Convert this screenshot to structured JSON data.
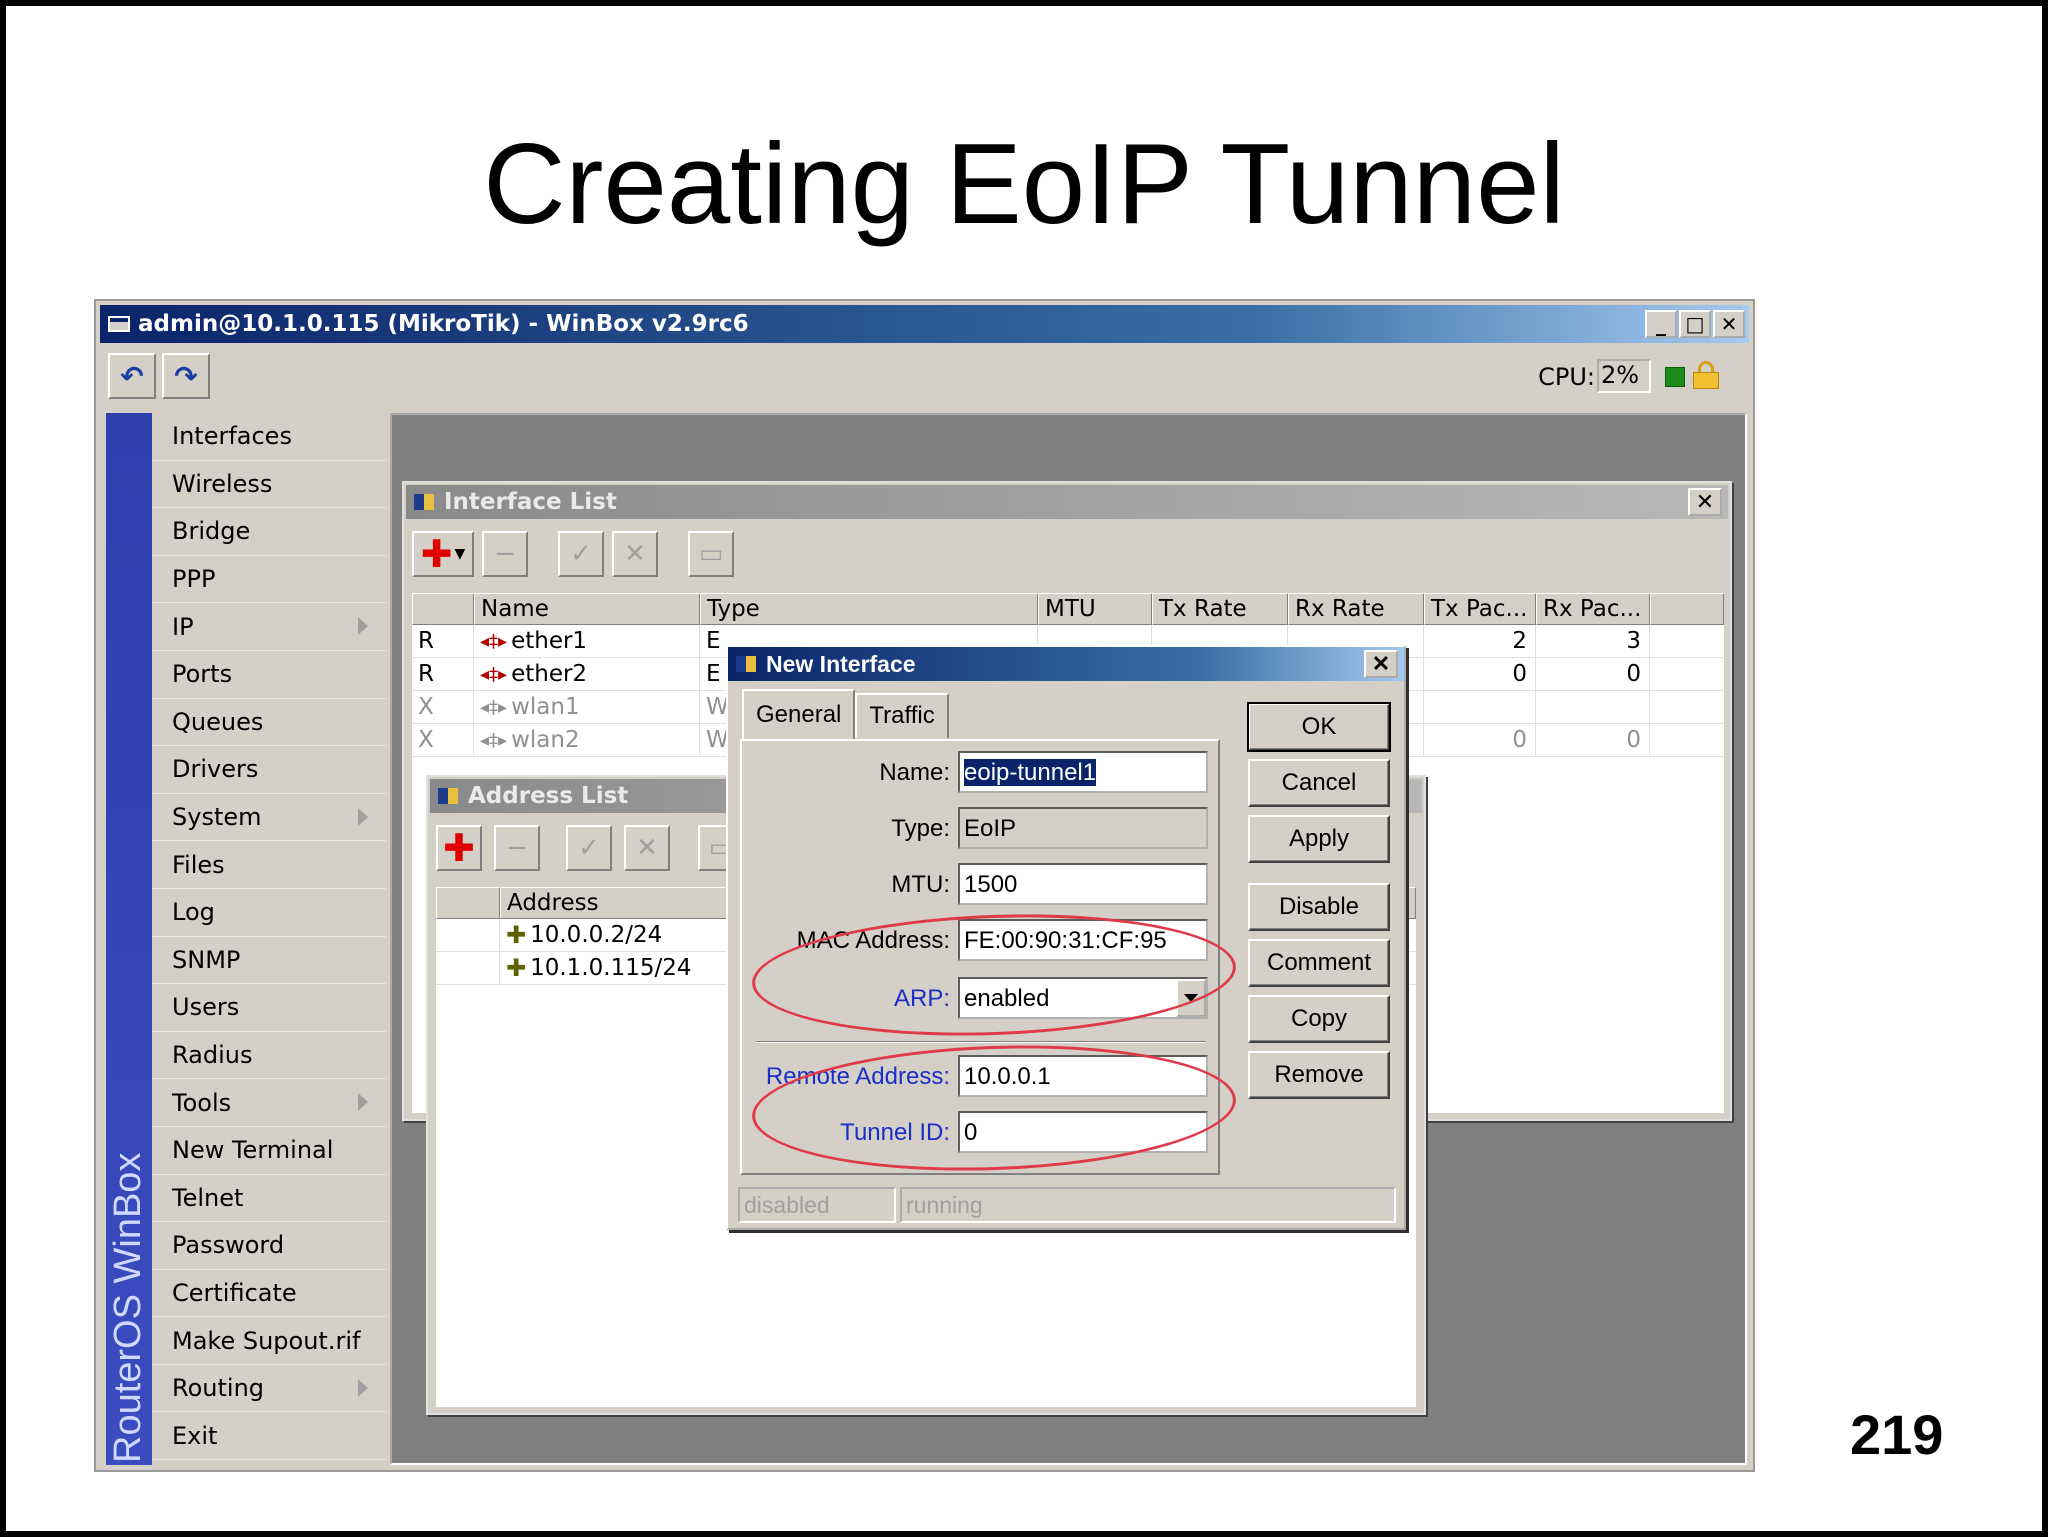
{
  "slide": {
    "title": "Creating EoIP Tunnel",
    "page_number": "219"
  },
  "winbox": {
    "title": "admin@10.1.0.115 (MikroTik) - WinBox v2.9rc6",
    "cpu_label": "CPU:",
    "cpu_value": "2%",
    "brand": "RouterOS WinBox",
    "menu": [
      {
        "label": "Interfaces",
        "submenu": false
      },
      {
        "label": "Wireless",
        "submenu": false
      },
      {
        "label": "Bridge",
        "submenu": false
      },
      {
        "label": "PPP",
        "submenu": false
      },
      {
        "label": "IP",
        "submenu": true
      },
      {
        "label": "Ports",
        "submenu": false
      },
      {
        "label": "Queues",
        "submenu": false
      },
      {
        "label": "Drivers",
        "submenu": false
      },
      {
        "label": "System",
        "submenu": true
      },
      {
        "label": "Files",
        "submenu": false
      },
      {
        "label": "Log",
        "submenu": false
      },
      {
        "label": "SNMP",
        "submenu": false
      },
      {
        "label": "Users",
        "submenu": false
      },
      {
        "label": "Radius",
        "submenu": false
      },
      {
        "label": "Tools",
        "submenu": true
      },
      {
        "label": "New Terminal",
        "submenu": false
      },
      {
        "label": "Telnet",
        "submenu": false
      },
      {
        "label": "Password",
        "submenu": false
      },
      {
        "label": "Certificate",
        "submenu": false
      },
      {
        "label": "Make Supout.rif",
        "submenu": false
      },
      {
        "label": "Routing",
        "submenu": true
      },
      {
        "label": "Exit",
        "submenu": false
      }
    ]
  },
  "interface_list": {
    "title": "Interface List",
    "columns": [
      "Name",
      "Type",
      "MTU",
      "Tx Rate",
      "Rx Rate",
      "Tx Pac...",
      "Rx Pac..."
    ],
    "rows": [
      {
        "flag": "R",
        "name": "ether1",
        "type": "E",
        "tx_pac": "2",
        "rx_pac": "3",
        "disabled": false
      },
      {
        "flag": "R",
        "name": "ether2",
        "type": "E",
        "tx_pac": "0",
        "rx_pac": "0",
        "disabled": false
      },
      {
        "flag": "X",
        "name": "wlan1",
        "type": "W",
        "tx_pac": "",
        "rx_pac": "",
        "disabled": true
      },
      {
        "flag": "X",
        "name": "wlan2",
        "type": "W",
        "tx_pac": "0",
        "rx_pac": "0",
        "disabled": true
      }
    ]
  },
  "address_list": {
    "title": "Address List",
    "column": "Address",
    "rows": [
      "10.0.0.2/24",
      "10.1.0.115/24"
    ]
  },
  "new_interface": {
    "title": "New Interface",
    "tabs": [
      "General",
      "Traffic"
    ],
    "fields": {
      "name": {
        "label": "Name:",
        "value": "eoip-tunnel1"
      },
      "type": {
        "label": "Type:",
        "value": "EoIP"
      },
      "mtu": {
        "label": "MTU:",
        "value": "1500"
      },
      "mac": {
        "label": "MAC Address:",
        "value": "FE:00:90:31:CF:95"
      },
      "arp": {
        "label": "ARP:",
        "value": "enabled"
      },
      "remote": {
        "label": "Remote Address:",
        "value": "10.0.0.1"
      },
      "tunnel_id": {
        "label": "Tunnel ID:",
        "value": "0"
      }
    },
    "buttons": {
      "ok": "OK",
      "cancel": "Cancel",
      "apply": "Apply",
      "disable": "Disable",
      "comment": "Comment",
      "copy": "Copy",
      "remove": "Remove"
    },
    "status": [
      "disabled",
      "running"
    ]
  },
  "colors": {
    "highlight_ellipse": "#e03a4a",
    "title_bar": "#0a246a",
    "window_face": "#d4d0c8"
  }
}
